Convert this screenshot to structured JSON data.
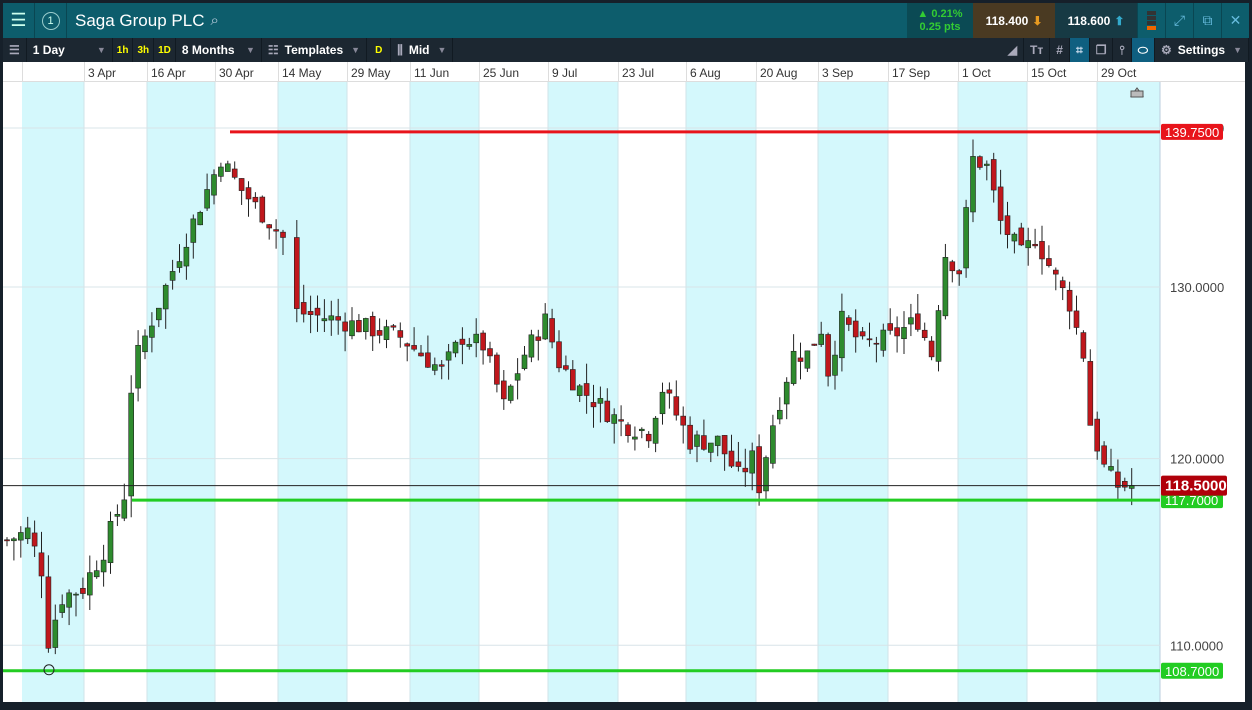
{
  "window": {
    "title": "Saga Group PLC",
    "badge": "1"
  },
  "quote": {
    "change_pct": "▲ 0.21%",
    "change_pts": "0.25 pts",
    "sell": "118.400",
    "buy": "118.600"
  },
  "toolbar": {
    "interval": "1 Day",
    "quick": [
      "1h",
      "3h",
      "1D"
    ],
    "range": "8 Months",
    "templates": "Templates",
    "d": "D",
    "price_type": "Mid",
    "settings": "Settings"
  },
  "colors": {
    "shade": "#d4f8fc",
    "up": "#2e8b2e",
    "down": "#c0171c",
    "red_line": "#e8141b",
    "green_line": "#22cc22"
  },
  "chart_data": {
    "type": "candlestick",
    "instrument": "Saga Group PLC",
    "x_labels": [
      "3 Apr",
      "16 Apr",
      "30 Apr",
      "14 May",
      "29 May",
      "11 Jun",
      "25 Jun",
      "9 Jul",
      "23 Jul",
      "6 Aug",
      "20 Aug",
      "3 Sep",
      "17 Sep",
      "1 Oct",
      "15 Oct",
      "29 Oct"
    ],
    "y_ticks": [
      "140.0000",
      "130.0000",
      "120.0000",
      "110.0000"
    ],
    "y_scale": "log",
    "close_keypoints_by_day": [
      [
        0,
        115.5
      ],
      [
        3,
        116
      ],
      [
        5,
        114
      ],
      [
        6,
        110.3
      ],
      [
        8,
        112.5
      ],
      [
        11,
        113
      ],
      [
        14,
        115
      ],
      [
        16,
        117
      ],
      [
        17,
        118
      ],
      [
        18,
        124
      ],
      [
        19,
        126
      ],
      [
        22,
        129
      ],
      [
        25,
        132
      ],
      [
        28,
        135
      ],
      [
        31,
        138
      ],
      [
        34,
        136
      ],
      [
        37,
        134.5
      ],
      [
        40,
        133
      ],
      [
        42,
        128.5
      ],
      [
        48,
        128
      ],
      [
        57,
        127
      ],
      [
        60,
        126
      ],
      [
        63,
        125
      ],
      [
        66,
        127
      ],
      [
        69,
        126.5
      ],
      [
        72,
        123
      ],
      [
        75,
        126
      ],
      [
        78,
        128
      ],
      [
        80,
        125.5
      ],
      [
        83,
        124
      ],
      [
        86,
        123
      ],
      [
        89,
        122
      ],
      [
        93,
        121.5
      ],
      [
        95,
        124
      ],
      [
        99,
        121
      ],
      [
        103,
        121
      ],
      [
        106,
        119
      ],
      [
        108,
        120
      ],
      [
        109,
        118.5
      ],
      [
        111,
        122
      ],
      [
        114,
        126
      ],
      [
        116,
        126
      ],
      [
        118,
        127.5
      ],
      [
        119,
        125
      ],
      [
        121,
        128
      ],
      [
        124,
        126.5
      ],
      [
        128,
        127
      ],
      [
        132,
        128
      ],
      [
        134,
        126
      ],
      [
        136,
        132
      ],
      [
        138,
        131
      ],
      [
        140,
        138
      ],
      [
        142,
        137.5
      ],
      [
        144,
        134
      ],
      [
        147,
        132
      ],
      [
        149,
        133
      ],
      [
        152,
        130.5
      ],
      [
        154,
        129
      ],
      [
        156,
        126
      ],
      [
        157,
        122
      ],
      [
        159,
        119.5
      ],
      [
        161,
        118.5
      ],
      [
        163,
        118.5
      ]
    ],
    "levels": [
      {
        "label": "139.7500",
        "value": 139.75,
        "color": "#e8141b"
      },
      {
        "label": "117.7000",
        "value": 117.7,
        "color": "#22cc22"
      },
      {
        "label": "108.7000",
        "value": 108.7,
        "color": "#22cc22"
      },
      {
        "label": "118.5000",
        "value": 118.5,
        "color": "#b0000a"
      }
    ]
  }
}
